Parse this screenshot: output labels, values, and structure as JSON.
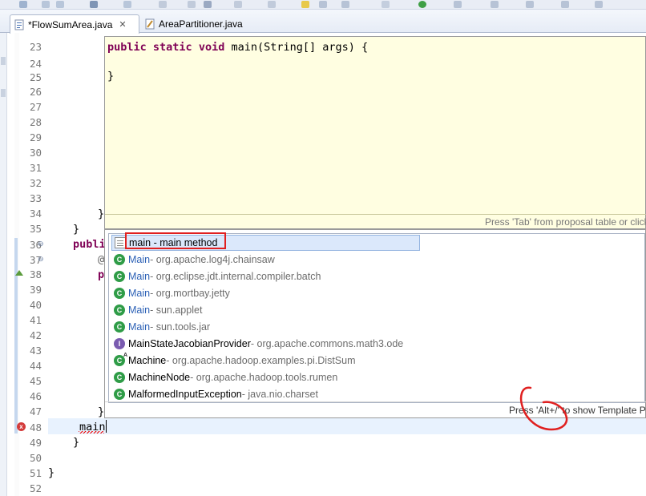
{
  "tabs": [
    {
      "label": "*FlowSumArea.java",
      "active": true,
      "close": "✕"
    },
    {
      "label": "AreaPartitioner.java",
      "active": false
    }
  ],
  "line_numbers": [
    "23",
    "24",
    "25",
    "26",
    "27",
    "28",
    "29",
    "30",
    "31",
    "32",
    "33",
    "34",
    "35",
    "36",
    "37",
    "38",
    "39",
    "40",
    "41",
    "42",
    "43",
    "44",
    "45",
    "46",
    "47",
    "48",
    "49",
    "50",
    "51",
    "52"
  ],
  "code_fragments": {
    "l34": "}",
    "l35": "}",
    "l36": "publi",
    "l37": "@",
    "l38": "p",
    "l47": "}",
    "l48": "main",
    "l49": "}",
    "l51": "}"
  },
  "preview": {
    "line1_kw1": "public",
    "line1_kw2": "static",
    "line1_kw3": "void",
    "line1_rest": " main(String[] args) {",
    "line2": "}",
    "footer": "Press 'Tab' from proposal table or click"
  },
  "proposals": {
    "items": [
      {
        "name": "main - main method",
        "qualifier": "",
        "type": "template",
        "highlight": "",
        "selected": true
      },
      {
        "name": "Main",
        "qualifier": " - org.apache.log4j.chainsaw",
        "type": "class"
      },
      {
        "name": "Main",
        "qualifier": " - org.eclipse.jdt.internal.compiler.batch",
        "type": "class"
      },
      {
        "name": "Main",
        "qualifier": " - org.mortbay.jetty",
        "type": "class"
      },
      {
        "name": "Main",
        "qualifier": " - sun.applet",
        "type": "class"
      },
      {
        "name": "Main",
        "qualifier": " - sun.tools.jar",
        "type": "class"
      },
      {
        "name": "MainStateJacobianProvider",
        "qualifier": " - org.apache.commons.math3.ode",
        "type": "interface"
      },
      {
        "name": "Machine",
        "qualifier": " - org.apache.hadoop.examples.pi.DistSum",
        "type": "abstract-class"
      },
      {
        "name": "MachineNode",
        "qualifier": " - org.apache.hadoop.tools.rumen",
        "type": "class"
      },
      {
        "name": "MalformedInputException",
        "qualifier": " - java.nio.charset",
        "type": "class"
      }
    ],
    "footer": "Press 'Alt+/' to show Template Pr"
  },
  "colors": {
    "keyword": "#7f0055",
    "match_highlight": "#2a5fb5",
    "annotation_red": "#e02020",
    "preview_bg": "#fffee1"
  }
}
